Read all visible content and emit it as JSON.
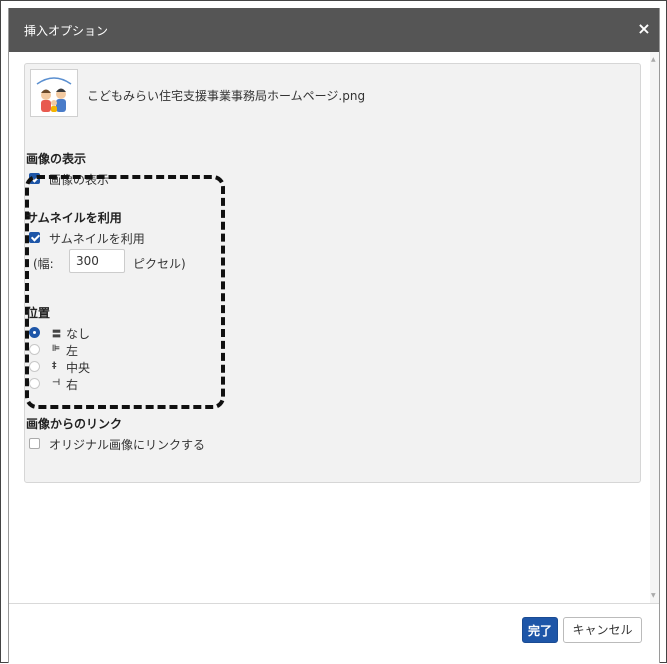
{
  "dialog": {
    "title": "挿入オプション",
    "close_symbol": "×"
  },
  "image": {
    "filename": "こどもみらい住宅支援事業事務局ホームページ.png"
  },
  "display_section": {
    "title": "画像の表示",
    "checkbox_label": "画像の表示",
    "checked": true
  },
  "thumbnail_section": {
    "title": "サムネイルを利用",
    "checkbox_label": "サムネイルを利用",
    "checked": true,
    "width_prefix": "(幅:",
    "width_value": "300",
    "width_suffix": "ピクセル)"
  },
  "position_section": {
    "title": "位置",
    "options": [
      {
        "icon": "align-none-icon",
        "glyph": "〓",
        "label": "なし",
        "selected": true
      },
      {
        "icon": "align-left-icon",
        "glyph": "⊫",
        "label": "左",
        "selected": false
      },
      {
        "icon": "align-center-icon",
        "glyph": "‡",
        "label": "中央",
        "selected": false
      },
      {
        "icon": "align-right-icon",
        "glyph": "⊣",
        "label": "右",
        "selected": false
      }
    ]
  },
  "link_section": {
    "title": "画像からのリンク",
    "checkbox_label": "オリジナル画像にリンクする",
    "checked": false
  },
  "footer": {
    "done_label": "完了",
    "cancel_label": "キャンセル"
  },
  "colors": {
    "titlebar": "#555555",
    "primary": "#1e56a8",
    "panel": "#f2f2f2"
  }
}
